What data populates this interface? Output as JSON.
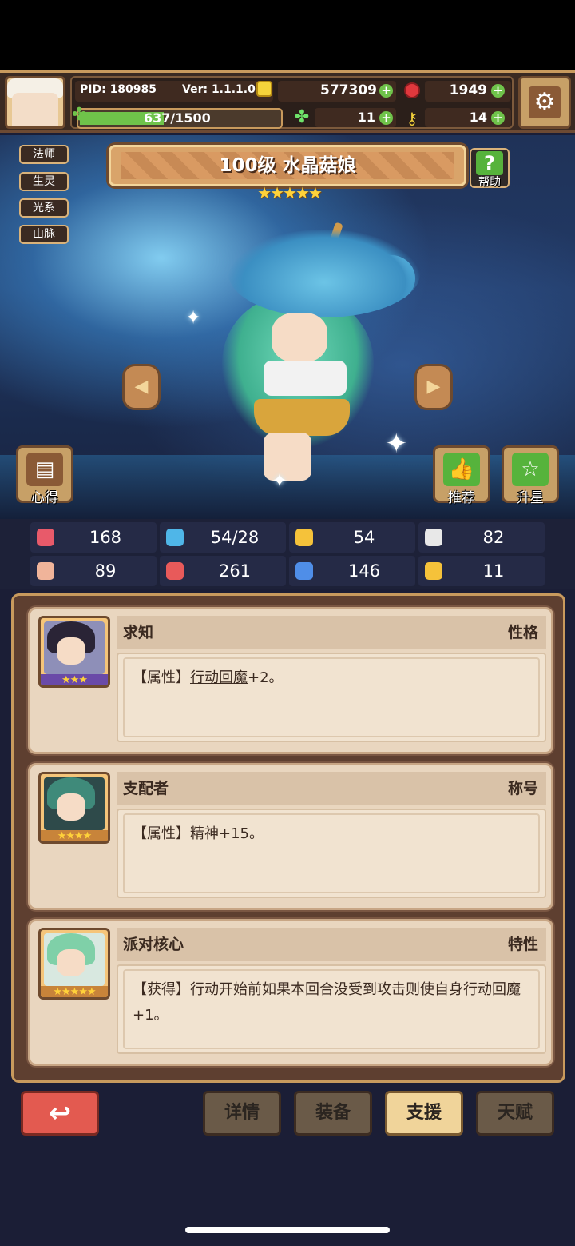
{
  "header": {
    "pid": "PID: 180985",
    "version": "Ver: 1.1.1.0",
    "gold": "577309",
    "rubies": "1949",
    "xp": "637/1500",
    "xp_fraction": 0.42,
    "clovers": "11",
    "keys": "14",
    "icons": {
      "settings": "gear-icon",
      "gold": "gold-coin-icon",
      "ruby": "ruby-icon",
      "clover": "clover-icon",
      "key": "key-icon"
    }
  },
  "character": {
    "tags": [
      "法师",
      "生灵",
      "光系",
      "山脉"
    ],
    "title": "100级 水晶菇娘",
    "stars": "★★★★★",
    "help_label": "帮助",
    "notes_label": "心得",
    "recommend_label": "推荐",
    "starup_label": "升星"
  },
  "stats": [
    {
      "icon": "heart-icon",
      "value": "168",
      "color": "#e85a6a"
    },
    {
      "icon": "water-drop-icon",
      "value": "54/28",
      "color": "#4fb6e8"
    },
    {
      "icon": "shield-icon",
      "value": "54",
      "color": "#f5c23a"
    },
    {
      "icon": "wing-icon",
      "value": "82",
      "color": "#e8e8e8"
    },
    {
      "icon": "fist-icon",
      "value": "89",
      "color": "#f0b49a"
    },
    {
      "icon": "spellbook-icon",
      "value": "261",
      "color": "#e85a5a"
    },
    {
      "icon": "scroll-icon",
      "value": "146",
      "color": "#4f8ee8"
    },
    {
      "icon": "horseshoe-icon",
      "value": "11",
      "color": "#f5c23a"
    }
  ],
  "support_cards": [
    {
      "name": "求知",
      "type": "性格",
      "prefix": "【属性】",
      "link": "行动回魔",
      "suffix": "+2。",
      "stars": "★★★"
    },
    {
      "name": "支配者",
      "type": "称号",
      "prefix": "【属性】",
      "link": "",
      "suffix": "精神+15。",
      "stars": "★★★★"
    },
    {
      "name": "派对核心",
      "type": "特性",
      "prefix": "【获得】",
      "link": "",
      "suffix": "行动开始前如果本回合没受到攻击则使自身行动回魔+1。",
      "stars": "★★★★★"
    }
  ],
  "nav": {
    "back": "↩",
    "tabs": [
      "详情",
      "装备",
      "支援",
      "天赋"
    ],
    "active": "支援"
  }
}
